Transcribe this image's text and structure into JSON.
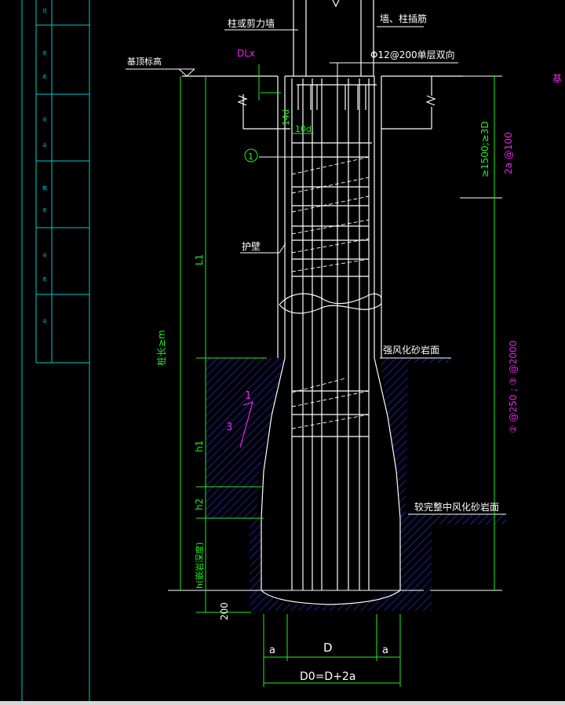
{
  "colors": {
    "background": "#000000",
    "lines": "#ffffff",
    "dimensions": "#22ee22",
    "reference": "#ee22ee",
    "hatch": "#3333ff",
    "title_block": "#00cccc"
  },
  "labels": {
    "column_wall": "柱或剪力墙",
    "wall_column_rebar": "墙、柱插筋",
    "foundation_top_elevation": "基顶标高",
    "dlx": "DLx",
    "rebar_mesh": "Φ12@200单层双向",
    "edge_tag": "基",
    "anchor_14d": "14d",
    "anchor_10d": "10d",
    "stirrup_circle": "1",
    "retaining_wall": "护壁",
    "strong_weathered": "强风化砂岩面",
    "moderate_weathered": "较完整中风化砂岩面",
    "slope_1": "1",
    "slope_3": "3",
    "pile_length": "桩长≥m",
    "L1": "L1",
    "h1": "h1",
    "h2": "h2",
    "h_rock": "h(嵌岩深度)",
    "dim_200": "200",
    "a_left": "a",
    "D": "D",
    "a_right": "a",
    "D0": "D0=D+2a",
    "dense_zone": "≥1500;≥3D",
    "stirrup_2a": "2a @100",
    "stirrup_23": "② @250 ; ③ @2000"
  },
  "title_block_rows": [
    "日",
    "名",
    "名",
    "号",
    "号",
    "期",
    "名",
    "号",
    "名",
    "号"
  ]
}
